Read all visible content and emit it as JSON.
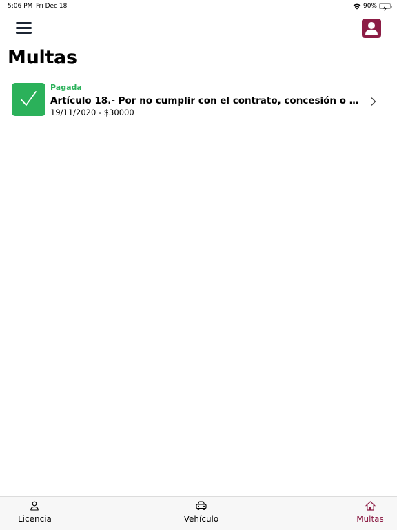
{
  "status_bar": {
    "time": "5:06 PM",
    "date": "Fri Dec 18",
    "battery_percent": "90%",
    "battery_level": 0.9,
    "battery_color": "#34c759"
  },
  "header": {
    "menu_icon": "hamburger-menu-icon",
    "profile_icon": "user-profile-icon",
    "profile_color": "#8c1d45"
  },
  "page": {
    "title": "Multas"
  },
  "fines": [
    {
      "status": "Pagada",
      "status_color": "#2bb15a",
      "status_icon": "checkmark-icon",
      "title": "Artículo 18.- Por no cumplir con el contrato, concesión o permiso",
      "date_amount": "19/11/2020 - $30000"
    }
  ],
  "tab_bar": {
    "active_color": "#8c1d45",
    "inactive_color": "#000000",
    "tabs": [
      {
        "label": "Licencia",
        "icon": "person-icon",
        "active": false
      },
      {
        "label": "Vehículo",
        "icon": "car-icon",
        "active": false
      },
      {
        "label": "Multas",
        "icon": "home-icon",
        "active": true
      }
    ]
  }
}
